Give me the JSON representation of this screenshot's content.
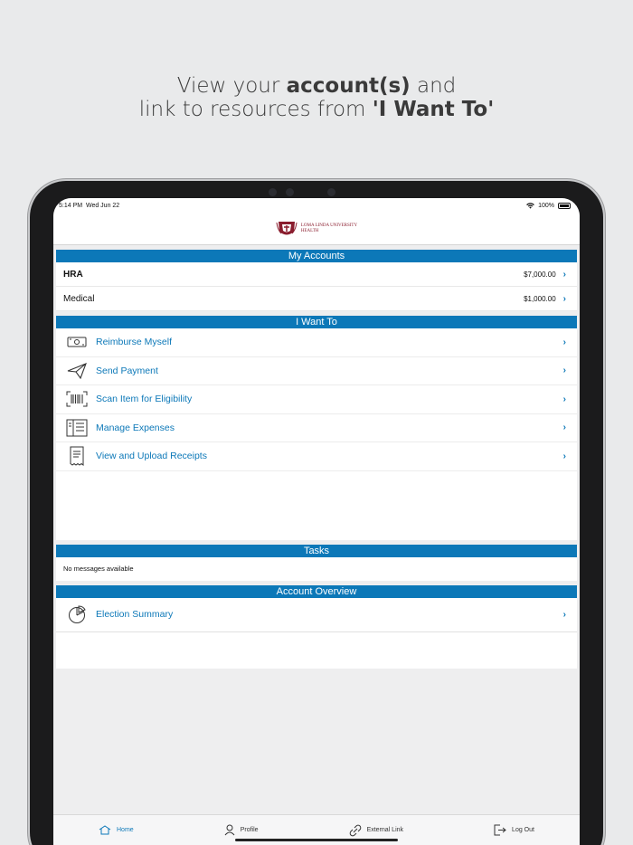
{
  "headline": {
    "line1_pre": "View your ",
    "line1_bold": "account(s)",
    "line1_post": " and",
    "line2_pre": "link to resources from ",
    "line2_bold": "'I Want To'"
  },
  "status_bar": {
    "time": "5:14 PM",
    "date": "Wed Jun 22",
    "battery": "100%"
  },
  "logo": {
    "line1": "LOMA LINDA UNIVERSITY",
    "line2": "HEALTH"
  },
  "my_accounts": {
    "title": "My Accounts",
    "rows": [
      {
        "name": "HRA",
        "amount": "$7,000.00"
      },
      {
        "name": "Medical",
        "amount": "$1,000.00"
      }
    ]
  },
  "i_want_to": {
    "title": "I Want To",
    "items": [
      {
        "label": "Reimburse Myself",
        "icon": "cash-icon"
      },
      {
        "label": "Send Payment",
        "icon": "paper-plane-icon"
      },
      {
        "label": "Scan Item for Eligibility",
        "icon": "barcode-icon"
      },
      {
        "label": "Manage Expenses",
        "icon": "ledger-icon"
      },
      {
        "label": "View and Upload Receipts",
        "icon": "receipt-icon"
      }
    ]
  },
  "tasks": {
    "title": "Tasks",
    "message": "No messages available"
  },
  "account_overview": {
    "title": "Account Overview",
    "items": [
      {
        "label": "Election Summary",
        "icon": "pie-chart-icon"
      }
    ]
  },
  "tab_bar": {
    "tabs": [
      {
        "label": "Home",
        "icon": "home-icon",
        "active": true
      },
      {
        "label": "Profile",
        "icon": "person-icon",
        "active": false
      },
      {
        "label": "External Link",
        "icon": "link-icon",
        "active": false
      },
      {
        "label": "Log Out",
        "icon": "logout-icon",
        "active": false
      }
    ]
  },
  "colors": {
    "accent": "#0c78b8",
    "brand": "#8a1d2e",
    "background": "#e9eaeb"
  }
}
